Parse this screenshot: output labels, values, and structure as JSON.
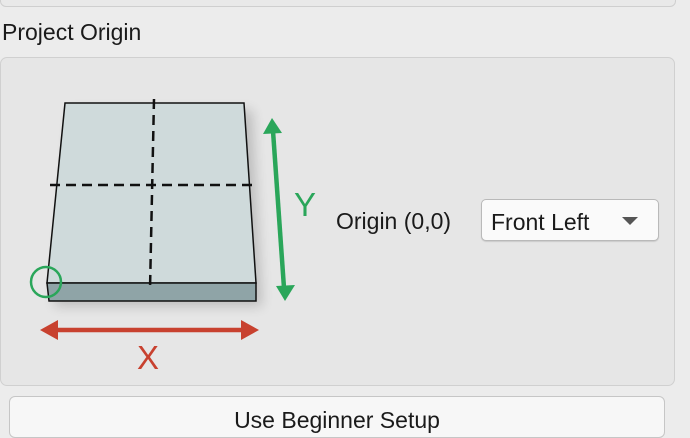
{
  "section": {
    "title": "Project Origin"
  },
  "diagram": {
    "x_label": "X",
    "y_label": "Y",
    "colors": {
      "x_axis": "#c8412f",
      "y_axis": "#2aa65a",
      "origin_marker": "#2aa65a",
      "board_top": "#cfdadb",
      "board_front": "#8fa4a7"
    }
  },
  "origin": {
    "label": "Origin (0,0)",
    "selected": "Front Left"
  },
  "bottom_button": {
    "label": "Use Beginner Setup"
  }
}
